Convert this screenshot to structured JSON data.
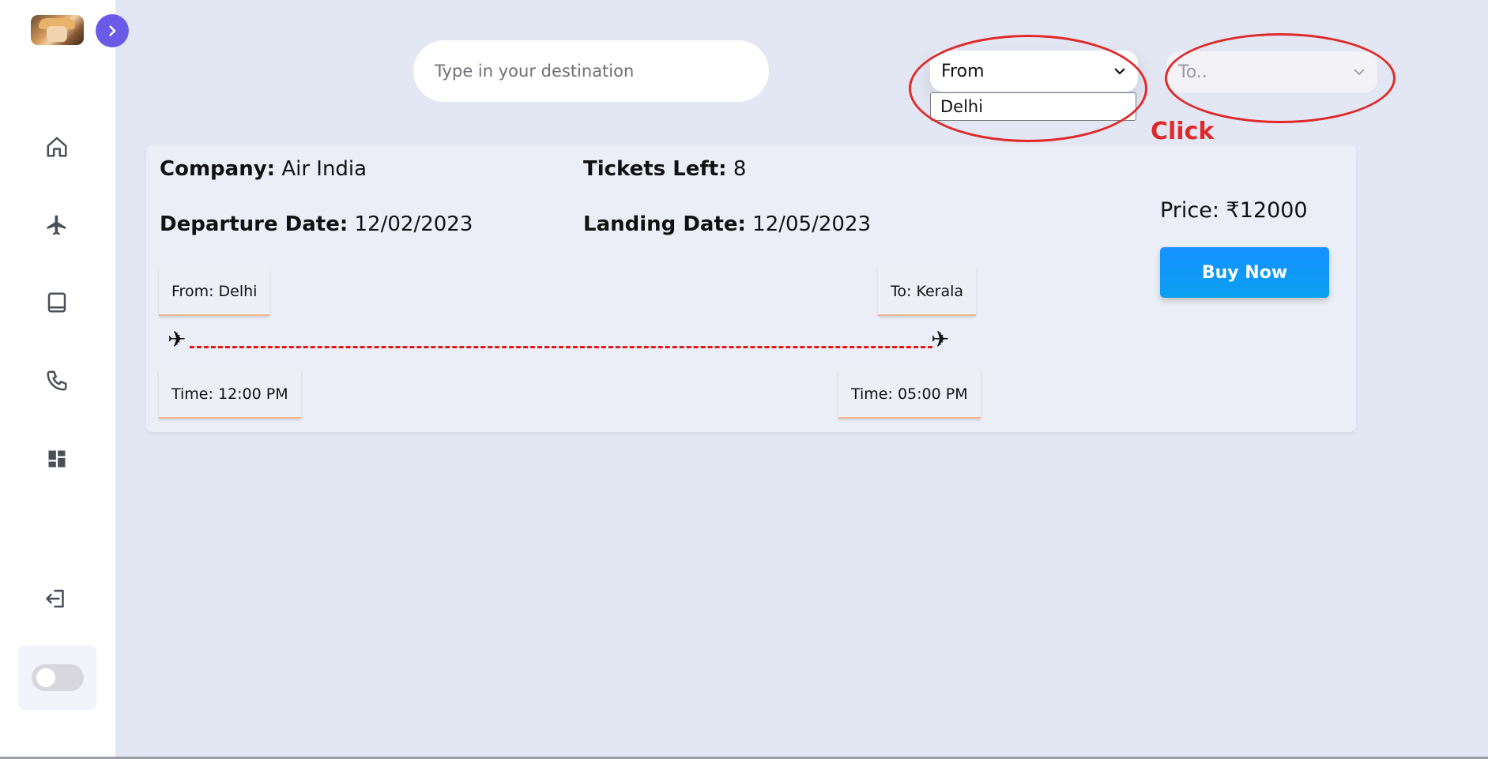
{
  "sidebar": {
    "icons": [
      "home-icon",
      "airplane-icon",
      "book-icon",
      "phone-icon",
      "dashboard-icon",
      "logout-icon"
    ]
  },
  "search": {
    "placeholder": "Type in your destination"
  },
  "from_select": {
    "value": "From",
    "option": "Delhi"
  },
  "to_select": {
    "value": "To.."
  },
  "annotation": {
    "label": "Click",
    "color": "#e02a2a"
  },
  "card": {
    "company_label": "Company:",
    "company": "Air India",
    "tickets_label": "Tickets Left:",
    "tickets": "8",
    "departure_label": "Departure Date:",
    "departure": "12/02/2023",
    "landing_label": "Landing Date:",
    "landing": "12/05/2023",
    "from": "From: Delhi",
    "to": "To: Kerala",
    "dep_time": "Time: 12:00 PM",
    "arr_time": "Time: 05:00 PM",
    "plane_glyph": "✈",
    "price": "Price: ₹12000",
    "buy_label": "Buy Now"
  },
  "colors": {
    "accent": "#6a5ae8",
    "button": "#1690ff",
    "route": "#e01818",
    "background": "#e3e7f4"
  }
}
